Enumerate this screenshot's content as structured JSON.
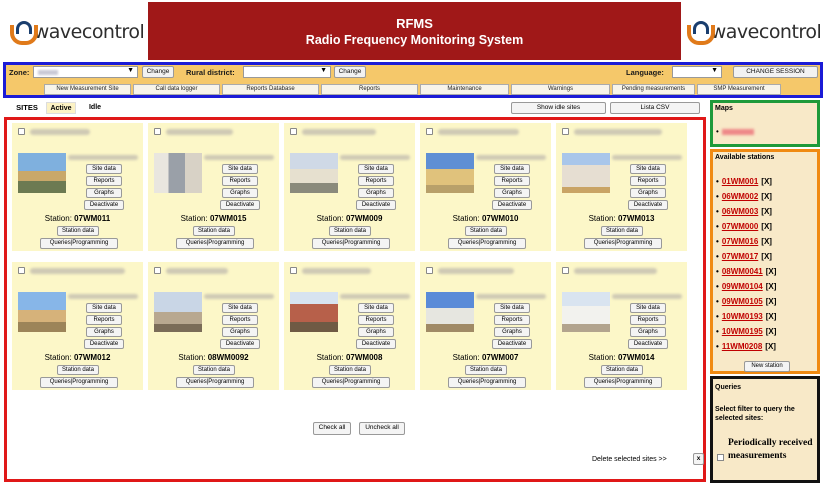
{
  "header": {
    "logo_text": "wavecontrol",
    "title": "RFMS",
    "subtitle": "Radio Frequency Monitoring System",
    "banner_color": "#a01818"
  },
  "toolbar": {
    "zone_label": "Zone:",
    "change_label": "Change",
    "rural_label": "Rural district:",
    "language_label": "Language:",
    "change_session_label": "CHANGE SESSION",
    "nav": [
      "New Measurement Site",
      "Call data logger",
      "Reports Database",
      "Reports",
      "Maintenance",
      "Warnings",
      "Pending measurements",
      "SMP Measurement"
    ]
  },
  "tabs": {
    "sites": "SITES",
    "active": "Active",
    "idle": "Idle",
    "show_idle": "Show idle sites",
    "csv": "Lista CSV"
  },
  "card_buttons": {
    "site_data": "Site data",
    "reports": "Reports",
    "graphs": "Graphs",
    "deactivate": "Deactivate",
    "station_prefix": "Station:",
    "station_data": "Station data",
    "queries": "Queries|Programming"
  },
  "cards": [
    {
      "station": "07WM011"
    },
    {
      "station": "07WM015"
    },
    {
      "station": "07WM009"
    },
    {
      "station": "07WM010"
    },
    {
      "station": "07WM013"
    },
    {
      "station": "07WM012"
    },
    {
      "station": "08WM0092"
    },
    {
      "station": "07WM008"
    },
    {
      "station": "07WM007"
    },
    {
      "station": "07WM014"
    }
  ],
  "footer": {
    "check_all": "Check all",
    "uncheck_all": "Uncheck all",
    "delete_selected": "Delete selected sites >>",
    "delete_x": "x"
  },
  "maps": {
    "title": "Maps"
  },
  "available": {
    "title": "Available stations",
    "items": [
      "01WM001",
      "06WM002",
      "06WM003",
      "07WM000",
      "07WM016",
      "07WM017",
      "08WM0041",
      "09WM0104",
      "09WM0105",
      "10WM0193",
      "10WM0195",
      "11WM0208"
    ],
    "x_label": "[X]",
    "new_station": "New station"
  },
  "queries": {
    "title": "Queries",
    "filter_text": "Select filter to query the selected sites:",
    "periodic": "Periodically received measurements"
  }
}
